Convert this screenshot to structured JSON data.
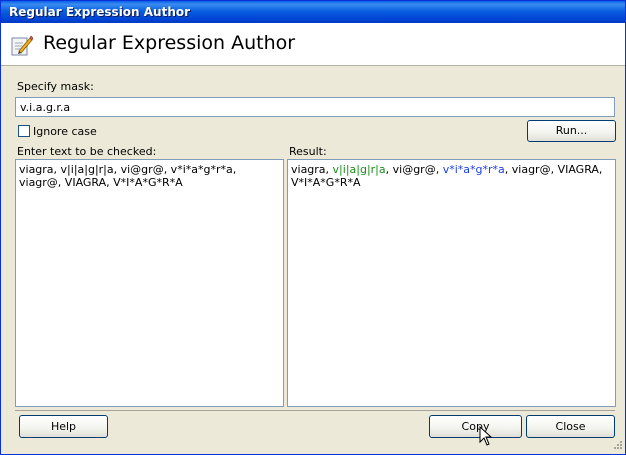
{
  "window": {
    "title": "Regular Expression Author",
    "header_title": "Regular Expression Author"
  },
  "mask": {
    "label": "Specify mask:",
    "value": "v.i.a.g.r.a"
  },
  "options": {
    "ignore_case_label": "Ignore case",
    "ignore_case_checked": false
  },
  "buttons": {
    "run": "Run...",
    "help": "Help",
    "copy": "Copy",
    "close": "Close"
  },
  "input_panel": {
    "label": "Enter text to be checked:",
    "text": "viagra, v|i|a|g|r|a, vi@gr@, v*i*a*g*r*a, viagr@, VIAGRA, V*I*A*G*R*A"
  },
  "result_panel": {
    "label": "Result:",
    "segments": [
      {
        "text": "viagra, ",
        "color": "#000000"
      },
      {
        "text": "v|i|a|g|r|a",
        "color": "#1a8b1a"
      },
      {
        "text": ", vi@gr@, ",
        "color": "#000000"
      },
      {
        "text": "v*i*a*g*r*a",
        "color": "#1a3ee0"
      },
      {
        "text": ", viagr@, VIAGRA, V*I*A*G*R*A",
        "color": "#000000"
      }
    ]
  },
  "icons": {
    "header": "edit-pencil-icon",
    "cursor": "mouse-pointer-icon"
  }
}
